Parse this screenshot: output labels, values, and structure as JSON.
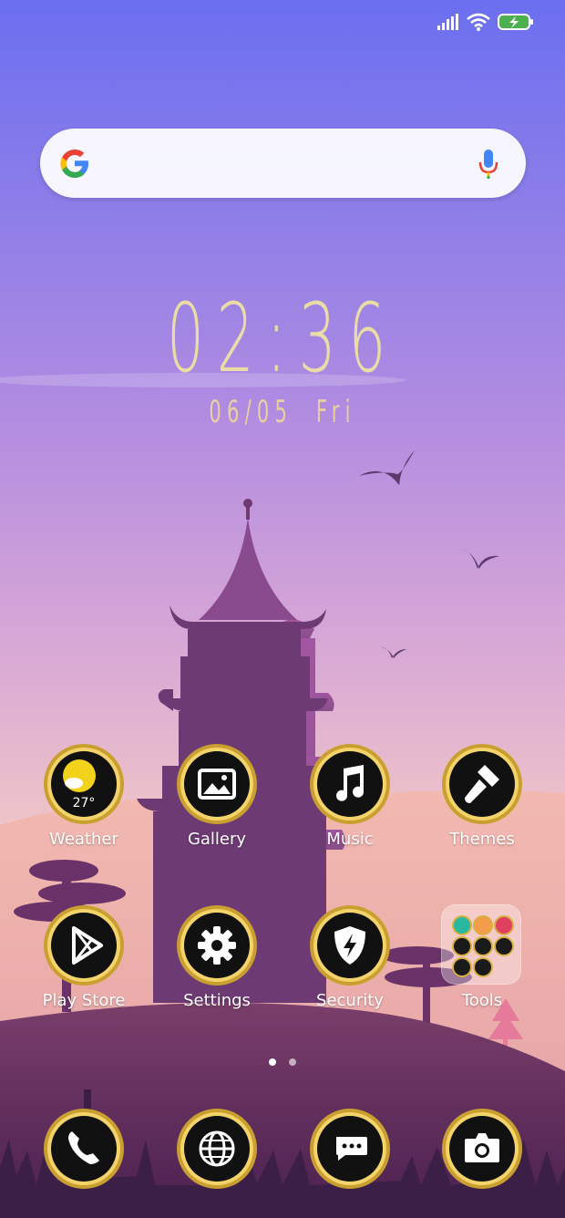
{
  "status_bar": {
    "signal_icon": "signal-icon",
    "wifi_icon": "wifi-icon",
    "battery_icon": "battery-charging-icon",
    "battery_color": "#4caf50"
  },
  "search": {
    "logo_icon": "google-g-icon",
    "voice_icon": "mic-icon"
  },
  "clock": {
    "time": "02:36",
    "date": "06/05",
    "weekday": "Fri"
  },
  "apps": [
    {
      "label": "Weather",
      "icon": "weather-icon",
      "temp": "27°"
    },
    {
      "label": "Gallery",
      "icon": "gallery-icon"
    },
    {
      "label": "Music",
      "icon": "music-note-icon"
    },
    {
      "label": "Themes",
      "icon": "paintbrush-icon"
    },
    {
      "label": "Play Store",
      "icon": "play-store-icon"
    },
    {
      "label": "Settings",
      "icon": "gear-icon"
    },
    {
      "label": "Security",
      "icon": "shield-bolt-icon"
    },
    {
      "label": "Tools",
      "icon": "folder-icon"
    }
  ],
  "pages": {
    "count": 2,
    "active": 0
  },
  "dock": [
    {
      "icon": "phone-icon"
    },
    {
      "icon": "globe-icon"
    },
    {
      "icon": "messages-icon"
    },
    {
      "icon": "camera-icon"
    }
  ]
}
